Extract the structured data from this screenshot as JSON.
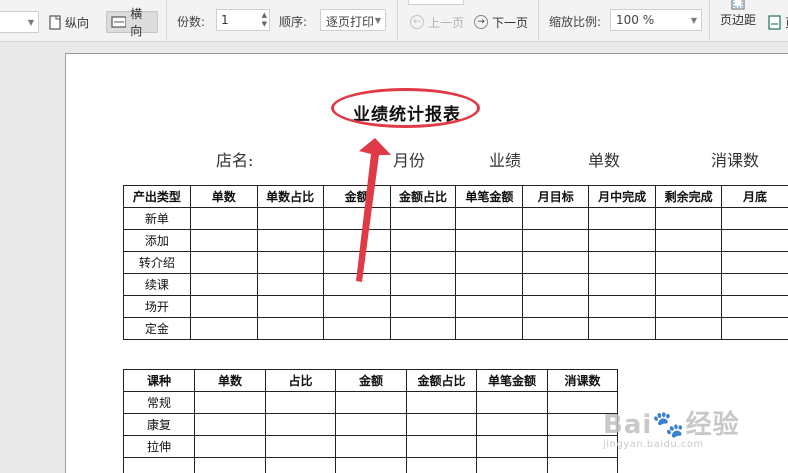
{
  "toolbar": {
    "portrait_label": "纵向",
    "landscape_label": "横向",
    "copies_label": "份数:",
    "copies_value": "1",
    "order_label": "顺序:",
    "order_value": "逐页打印",
    "prev_page_label": "上一页",
    "next_page_label": "下一页",
    "zoom_label": "缩放比例:",
    "zoom_value": "100 %",
    "margins_label": "页边距",
    "last_label": "页"
  },
  "document": {
    "title": "业绩统计报表",
    "info": {
      "store": "店名:",
      "month": "月份",
      "performance": "业绩",
      "orders": "单数",
      "lessons": "消课数"
    },
    "table1": {
      "headers": [
        "产出类型",
        "单数",
        "单数占比",
        "金额",
        "金额占比",
        "单笔金额",
        "月目标",
        "月中完成",
        "剩余完成",
        "月底"
      ],
      "rows": [
        "新单",
        "添加",
        "转介绍",
        "续课",
        "场开",
        "定金"
      ]
    },
    "table2": {
      "headers": [
        "课种",
        "单数",
        "占比",
        "金额",
        "金额占比",
        "单笔金额",
        "消课数"
      ],
      "rows": [
        "常规",
        "康复",
        "拉伸",
        ""
      ]
    }
  },
  "watermark": {
    "main": "Bai🐾经验",
    "sub": "jingyan.baidu.com"
  },
  "colors": {
    "highlight": "#e03a47",
    "toolbar_bg": "#f3f3f3",
    "canvas_bg": "#e9e9e9"
  }
}
